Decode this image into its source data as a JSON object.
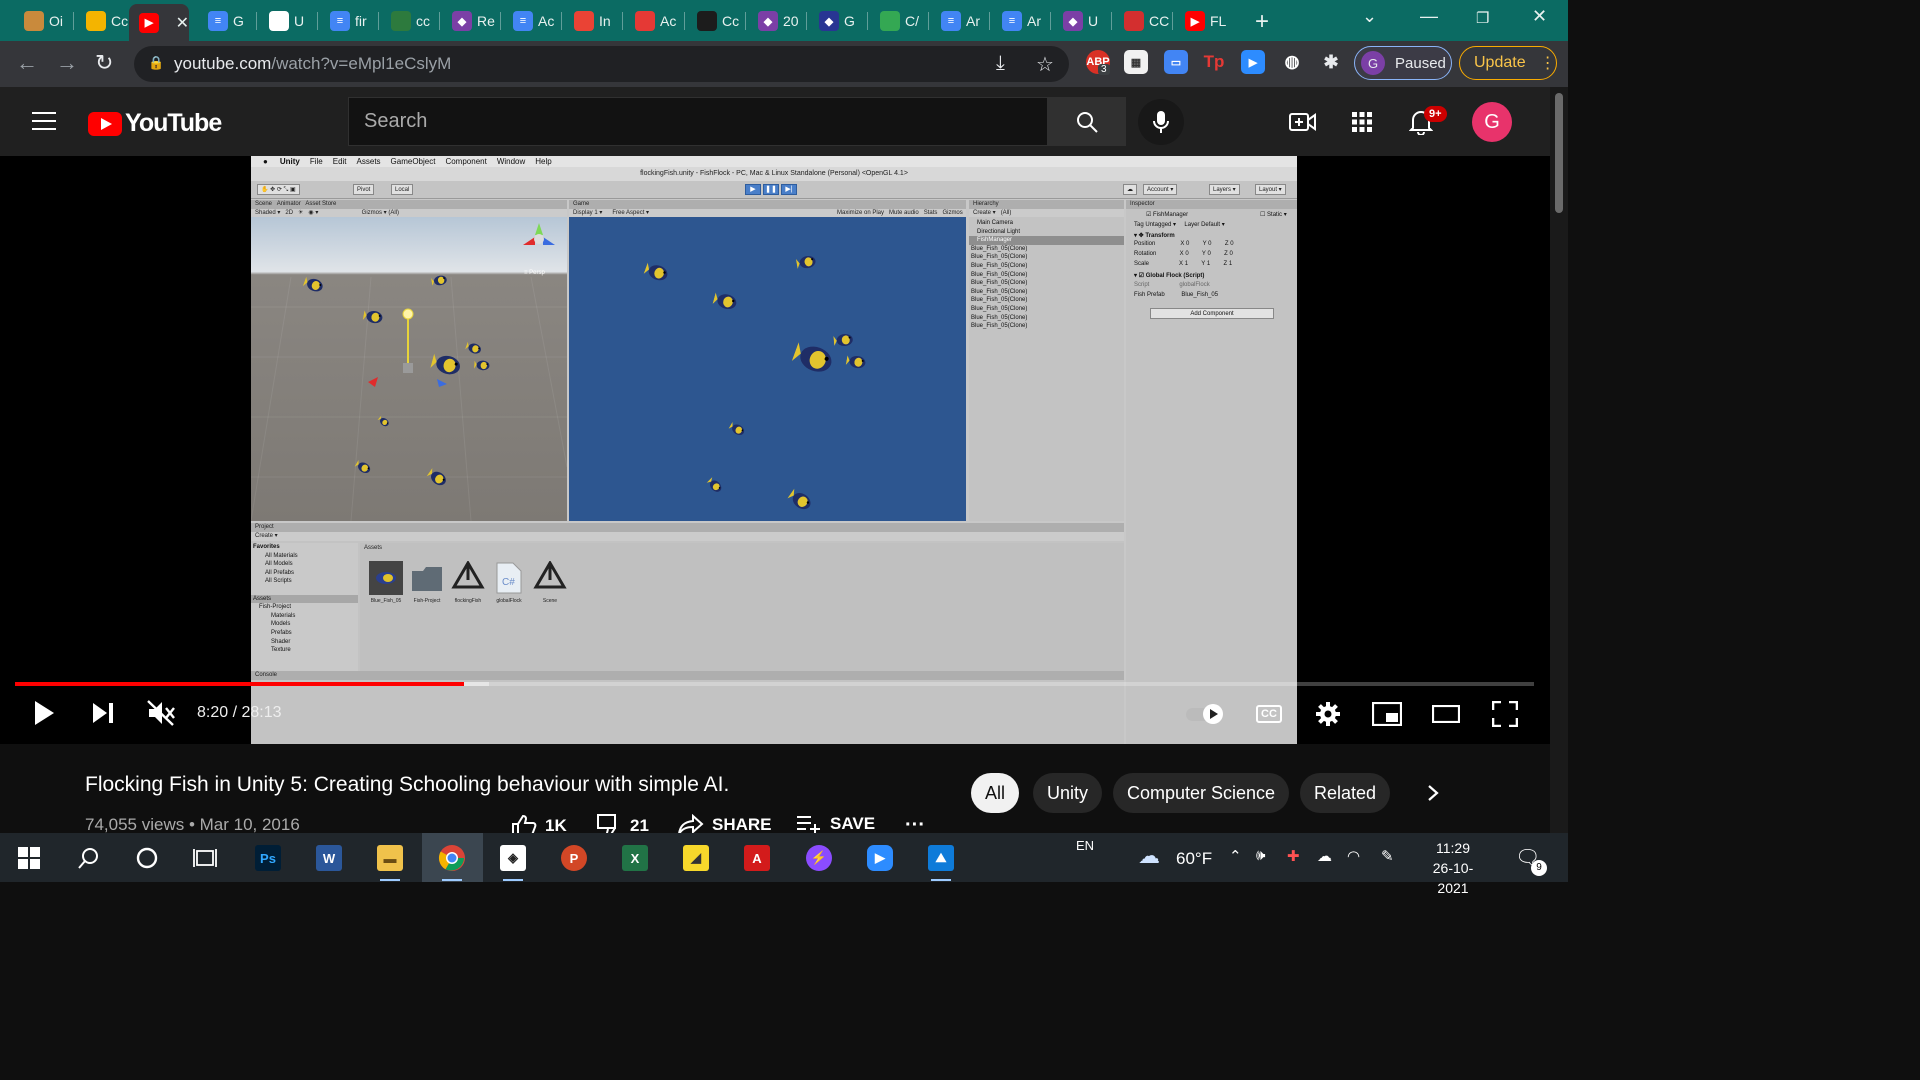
{
  "browser": {
    "tabs": [
      {
        "label": "Oi",
        "color": "#c98a3c",
        "glyph": "person-icon"
      },
      {
        "label": "Cc",
        "color": "#f4b400",
        "glyph": "slides-icon"
      },
      {
        "label": "",
        "color": "#ff0000",
        "glyph": "youtube-icon",
        "active": true
      },
      {
        "label": "G",
        "color": "#4285f4",
        "glyph": "docs-icon"
      },
      {
        "label": "U",
        "color": "#ffffff",
        "glyph": "github-icon"
      },
      {
        "label": "fir",
        "color": "#4285f4",
        "glyph": "docs-icon"
      },
      {
        "label": "cc",
        "color": "#2d7a3d",
        "glyph": "cm-icon"
      },
      {
        "label": "Re",
        "color": "#7b3fa6",
        "glyph": "pin-icon"
      },
      {
        "label": "Ac",
        "color": "#4285f4",
        "glyph": "docs-icon"
      },
      {
        "label": "In",
        "color": "#ea4335",
        "glyph": "gmail-icon"
      },
      {
        "label": "Ac",
        "color": "#e53935",
        "glyph": "hh-icon"
      },
      {
        "label": "Cc",
        "color": "#1c1c1c",
        "glyph": "c-icon"
      },
      {
        "label": "20",
        "color": "#7b3fa6",
        "glyph": "pin-icon"
      },
      {
        "label": "G",
        "color": "#283593",
        "glyph": "pin-icon"
      },
      {
        "label": "C/",
        "color": "#34a853",
        "glyph": "drive-icon"
      },
      {
        "label": "Ar",
        "color": "#4285f4",
        "glyph": "docs-icon"
      },
      {
        "label": "Ar",
        "color": "#4285f4",
        "glyph": "docs-icon"
      },
      {
        "label": "U",
        "color": "#7b3fa6",
        "glyph": "pin-icon"
      },
      {
        "label": "CC",
        "color": "#d32f2f",
        "glyph": "w-icon"
      },
      {
        "label": "FL",
        "color": "#ff0000",
        "glyph": "youtube-icon"
      }
    ],
    "url_host": "youtube.com",
    "url_path": "/watch?v=eMpl1eCslyM",
    "profile_initial": "G",
    "profile_status": "Paused",
    "update_label": "Update",
    "ext_badge_abp": "3"
  },
  "youtube": {
    "logo_text": "YouTube",
    "search_placeholder": "Search",
    "notifications_badge": "9+",
    "avatar_initial": "G"
  },
  "video_frame": {
    "unity_menu": [
      "Unity",
      "File",
      "Edit",
      "Assets",
      "GameObject",
      "Component",
      "Window",
      "Help"
    ],
    "window_title": "flockingFish.unity - FishFlock - PC, Mac & Linux Standalone (Personal) <OpenGL 4.1>",
    "scene_tabs": [
      "Scene",
      "Animator",
      "Asset Store"
    ],
    "game_tab": "Game",
    "game_toolbar": [
      "Display 1",
      "Free Aspect",
      "Maximize on Play",
      "Mute audio",
      "Stats",
      "Gizmos"
    ],
    "hierarchy_title": "Hierarchy",
    "hierarchy_items": [
      "Main Camera",
      "Directional Light",
      "FishManager",
      "Blue_Fish_05(Clone)",
      "Blue_Fish_05(Clone)",
      "Blue_Fish_05(Clone)",
      "Blue_Fish_05(Clone)",
      "Blue_Fish_05(Clone)",
      "Blue_Fish_05(Clone)",
      "Blue_Fish_05(Clone)",
      "Blue_Fish_05(Clone)",
      "Blue_Fish_05(Clone)",
      "Blue_Fish_05(Clone)"
    ],
    "inspector": {
      "title": "Inspector",
      "object_name": "FishManager",
      "static_label": "Static",
      "tag": "Untagged",
      "layer": "Default",
      "transform_label": "Transform",
      "position": [
        "0",
        "0",
        "0"
      ],
      "rotation": [
        "0",
        "0",
        "0"
      ],
      "scale": [
        "1",
        "1",
        "1"
      ],
      "script_component": "Global Flock (Script)",
      "script_field": "globalFlock",
      "fish_prefab": "Blue_Fish_05",
      "add_component": "Add Component"
    },
    "project_title": "Project",
    "favorites": [
      "Favorites",
      "All Materials",
      "All Models",
      "All Prefabs",
      "All Scripts"
    ],
    "assets_tree": [
      "Assets",
      "Fish-Project",
      "Materials",
      "Models",
      "Prefabs",
      "Shader",
      "Texture"
    ],
    "assets_header": "Assets",
    "assets": [
      "Blue_Fish_05",
      "Fish-Project",
      "flockingFish",
      "globalFlock",
      "Scene"
    ],
    "console_title": "Console"
  },
  "player": {
    "current_time": "8:20",
    "duration": "28:13",
    "time_display": "8:20 / 28:13",
    "played_fraction": 0.2955,
    "buffered_fraction": 0.312,
    "autoplay_on": true,
    "cc_label": "CC"
  },
  "video": {
    "title": "Flocking Fish in Unity 5: Creating Schooling behaviour with simple AI.",
    "views": "74,055 views",
    "date": "Mar 10, 2016",
    "meta": "74,055 views • Mar 10, 2016",
    "likes": "1K",
    "dislikes": "21",
    "share_label": "SHARE",
    "save_label": "SAVE"
  },
  "chips": [
    "All",
    "Unity",
    "Computer Science",
    "Related"
  ],
  "taskbar": {
    "language": "EN",
    "temperature": "60°F",
    "time": "11:29",
    "date": "26-10-2021",
    "notifications": "9"
  }
}
